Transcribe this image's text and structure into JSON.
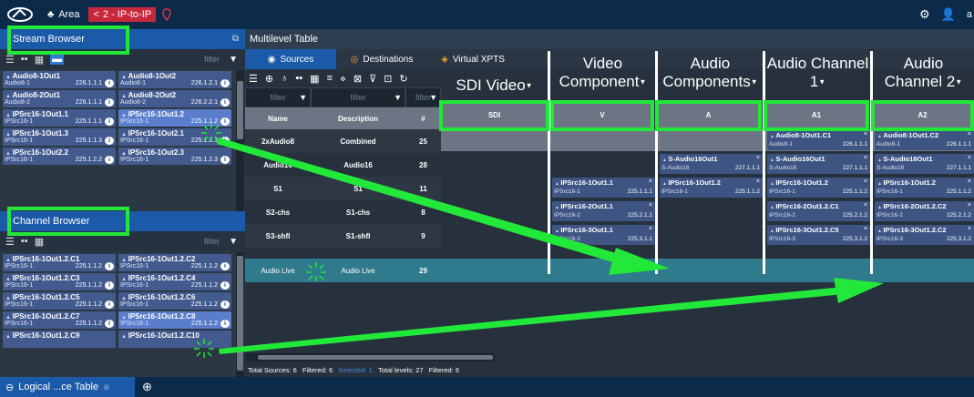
{
  "topbar": {
    "area_label": "Area",
    "crumb_label": "2 - IP-to-IP",
    "user_label": "a"
  },
  "stream_browser": {
    "title": "Stream Browser",
    "filter_placeholder": "filter",
    "tiles": [
      {
        "name": "Audio8-1Out1",
        "src": "Audio8-1",
        "ip": "226.1.1.1"
      },
      {
        "name": "Audio8-1Out2",
        "src": "Audio8-1",
        "ip": "226.1.2.1"
      },
      {
        "name": "Audio8-2Out1",
        "src": "Audio8-2",
        "ip": "226.1.1.1"
      },
      {
        "name": "Audio8-2Out2",
        "src": "Audio8-2",
        "ip": "226.2.2.1"
      },
      {
        "name": "IPSrc16-1Out1.1",
        "src": "IPSrc16-1",
        "ip": "225.1.1.1"
      },
      {
        "name": "IPSrc16-1Out1.2",
        "src": "IPSrc16-1",
        "ip": "225.1.1.2"
      },
      {
        "name": "IPSrc16-1Out1.3",
        "src": "IPSrc16-1",
        "ip": "225.1.1.3"
      },
      {
        "name": "IPSrc16-1Out2.1",
        "src": "IPSrc16-1",
        "ip": "225.1.2.1"
      },
      {
        "name": "IPSrc16-1Out2.2",
        "src": "IPSrc16-1",
        "ip": "225.1.2.2"
      },
      {
        "name": "IPSrc16-1Out2.3",
        "src": "IPSrc16-1",
        "ip": "225.1.2.3"
      }
    ]
  },
  "channel_browser": {
    "title": "Channel Browser",
    "filter_placeholder": "filter",
    "tiles": [
      {
        "name": "IPSrc16-1Out1.2.C1",
        "src": "IPSrc16-1",
        "ip": "225.1.1.2"
      },
      {
        "name": "IPSrc16-1Out1.2.C2",
        "src": "IPSrc16-1",
        "ip": "225.1.1.2"
      },
      {
        "name": "IPSrc16-1Out1.2.C3",
        "src": "IPSrc16-1",
        "ip": "225.1.1.2"
      },
      {
        "name": "IPSrc16-1Out1.2.C4",
        "src": "IPSrc16-1",
        "ip": "225.1.1.2"
      },
      {
        "name": "IPSrc16-1Out1.2.C5",
        "src": "IPSrc16-1",
        "ip": "225.1.1.2"
      },
      {
        "name": "IPSrc16-1Out1.2.C6",
        "src": "IPSrc16-1",
        "ip": "225.1.1.2"
      },
      {
        "name": "IPSrc16-1Out1.2.C7",
        "src": "IPSrc16-1",
        "ip": "225.1.1.2"
      },
      {
        "name": "IPSrc16-1Out1.2.C8",
        "src": "IPSrc16-1",
        "ip": "225.1.1.2"
      },
      {
        "name": "IPSrc16-1Out1.2.C9",
        "src": "",
        "ip": ""
      },
      {
        "name": "IPSrc16-1Out1.2.C10",
        "src": "",
        "ip": ""
      }
    ]
  },
  "table": {
    "title": "Multilevel Table",
    "tabs": [
      "Sources",
      "Destinations",
      "Virtual XPTS"
    ],
    "filter_placeholder": "filter",
    "col_name": "Name",
    "col_desc": "Description",
    "col_num": "#",
    "rows": [
      {
        "name": "2xAudio8",
        "desc": "Combined",
        "num": "25"
      },
      {
        "name": "Audio16",
        "desc": "Audio16",
        "num": "28"
      },
      {
        "name": "S1",
        "desc": "S1",
        "num": "11"
      },
      {
        "name": "S2-chs",
        "desc": "S1-chs",
        "num": "8"
      },
      {
        "name": "S3-shfl",
        "desc": "S1-shfl",
        "num": "9"
      },
      {
        "name": "Audio Live",
        "desc": "Audio Live",
        "num": "29"
      }
    ],
    "level_headers": [
      {
        "label": "SDI Video",
        "short": "SDI"
      },
      {
        "label": "Video Component",
        "short": "V"
      },
      {
        "label": "Audio Components",
        "short": "A"
      },
      {
        "label": "Audio Channel 1",
        "short": "A1"
      },
      {
        "label": "Audio Channel 2",
        "short": "A2"
      }
    ],
    "chips": {
      "v_s1": {
        "name": "IPSrc16-1Out1.1",
        "src": "IPSrc16-1",
        "ip": "225.1.1.1"
      },
      "v_s2": {
        "name": "IPSrc16-2Out1.1",
        "src": "IPSrc16-2",
        "ip": "225.2.1.1"
      },
      "v_s3": {
        "name": "IPSrc16-3Out1.1",
        "src": "IPSrc16-3",
        "ip": "225.3.1.1"
      },
      "a_audio16": {
        "name": "S-Audio16Out1",
        "src": "S-Audio16",
        "ip": "227.1.1.1"
      },
      "a_s1": {
        "name": "IPSrc16-1Out1.2",
        "src": "IPSrc16-1",
        "ip": "225.1.1.2"
      },
      "a1_2x": {
        "name": "Audio8-1Out1.C1",
        "src": "Audio8-1",
        "ip": "226.1.1.1"
      },
      "a1_audio16": {
        "name": "S-Audio16Out1",
        "src": "S-Audio16",
        "ip": "227.1.1.1"
      },
      "a1_s1": {
        "name": "IPSrc16-1Out1.2",
        "src": "IPSrc16-1",
        "ip": "225.1.1.2"
      },
      "a1_s2": {
        "name": "IPSrc16-2Out1.2.C1",
        "src": "IPSrc16-2",
        "ip": "225.2.1.2"
      },
      "a1_s3": {
        "name": "IPSrc16-3Out1.2.C5",
        "src": "IPSrc16-3",
        "ip": "225.3.1.2"
      },
      "a2_2x": {
        "name": "Audio8-1Out1.C2",
        "src": "Audio8-1",
        "ip": "226.1.1.1"
      },
      "a2_audio16": {
        "name": "S-Audio16Out1",
        "src": "S-Audio16",
        "ip": "227.1.1.1"
      },
      "a2_s1": {
        "name": "IPSrc16-1Out1.2",
        "src": "IPSrc16-1",
        "ip": "225.1.1.2"
      },
      "a2_s2": {
        "name": "IPSrc16-2Out1.2.C2",
        "src": "IPSrc16-2",
        "ip": "225.2.1.2"
      },
      "a2_s3": {
        "name": "IPSrc16-3Out1.2.C2",
        "src": "IPSrc16-3",
        "ip": "225.3.1.2"
      }
    },
    "status": {
      "total_sources": "Total Sources: 6",
      "filtered": "Filtered: 6",
      "selected": "Selected: 1",
      "total_levels": "Total levels: 27",
      "filtered2": "Filtered: 6"
    }
  },
  "bottombar": {
    "tab_label": "Logical ...ce Table"
  },
  "colors": {
    "highlight": "#22e83a",
    "panel_title": "#1b5aa8",
    "tile": "#425a8e",
    "selected_row": "#2f7a8c"
  }
}
